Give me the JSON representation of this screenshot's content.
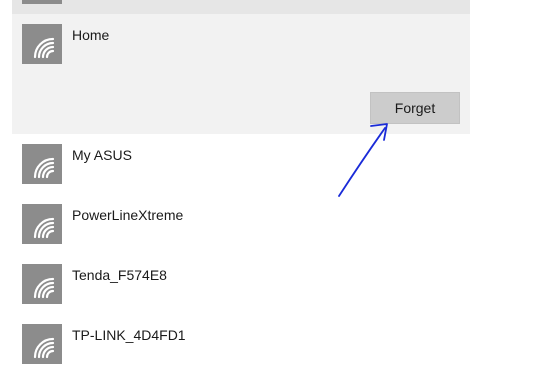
{
  "colors": {
    "tile": "#8c8c8c",
    "selected_bg": "#f2f2f2",
    "button_bg": "#cccccc",
    "annotation": "#1a2bd8"
  },
  "networks": [
    {
      "name": "",
      "icon": "wifi-icon"
    },
    {
      "name": "Home",
      "icon": "wifi-icon"
    },
    {
      "name": "My ASUS",
      "icon": "wifi-icon"
    },
    {
      "name": "PowerLineXtreme",
      "icon": "wifi-icon"
    },
    {
      "name": "Tenda_F574E8",
      "icon": "wifi-icon"
    },
    {
      "name": "TP-LINK_4D4FD1",
      "icon": "wifi-icon"
    }
  ],
  "selected": {
    "forget_label": "Forget"
  },
  "annotation": {
    "type": "hand-drawn-arrow",
    "points_to": "forget-button"
  }
}
